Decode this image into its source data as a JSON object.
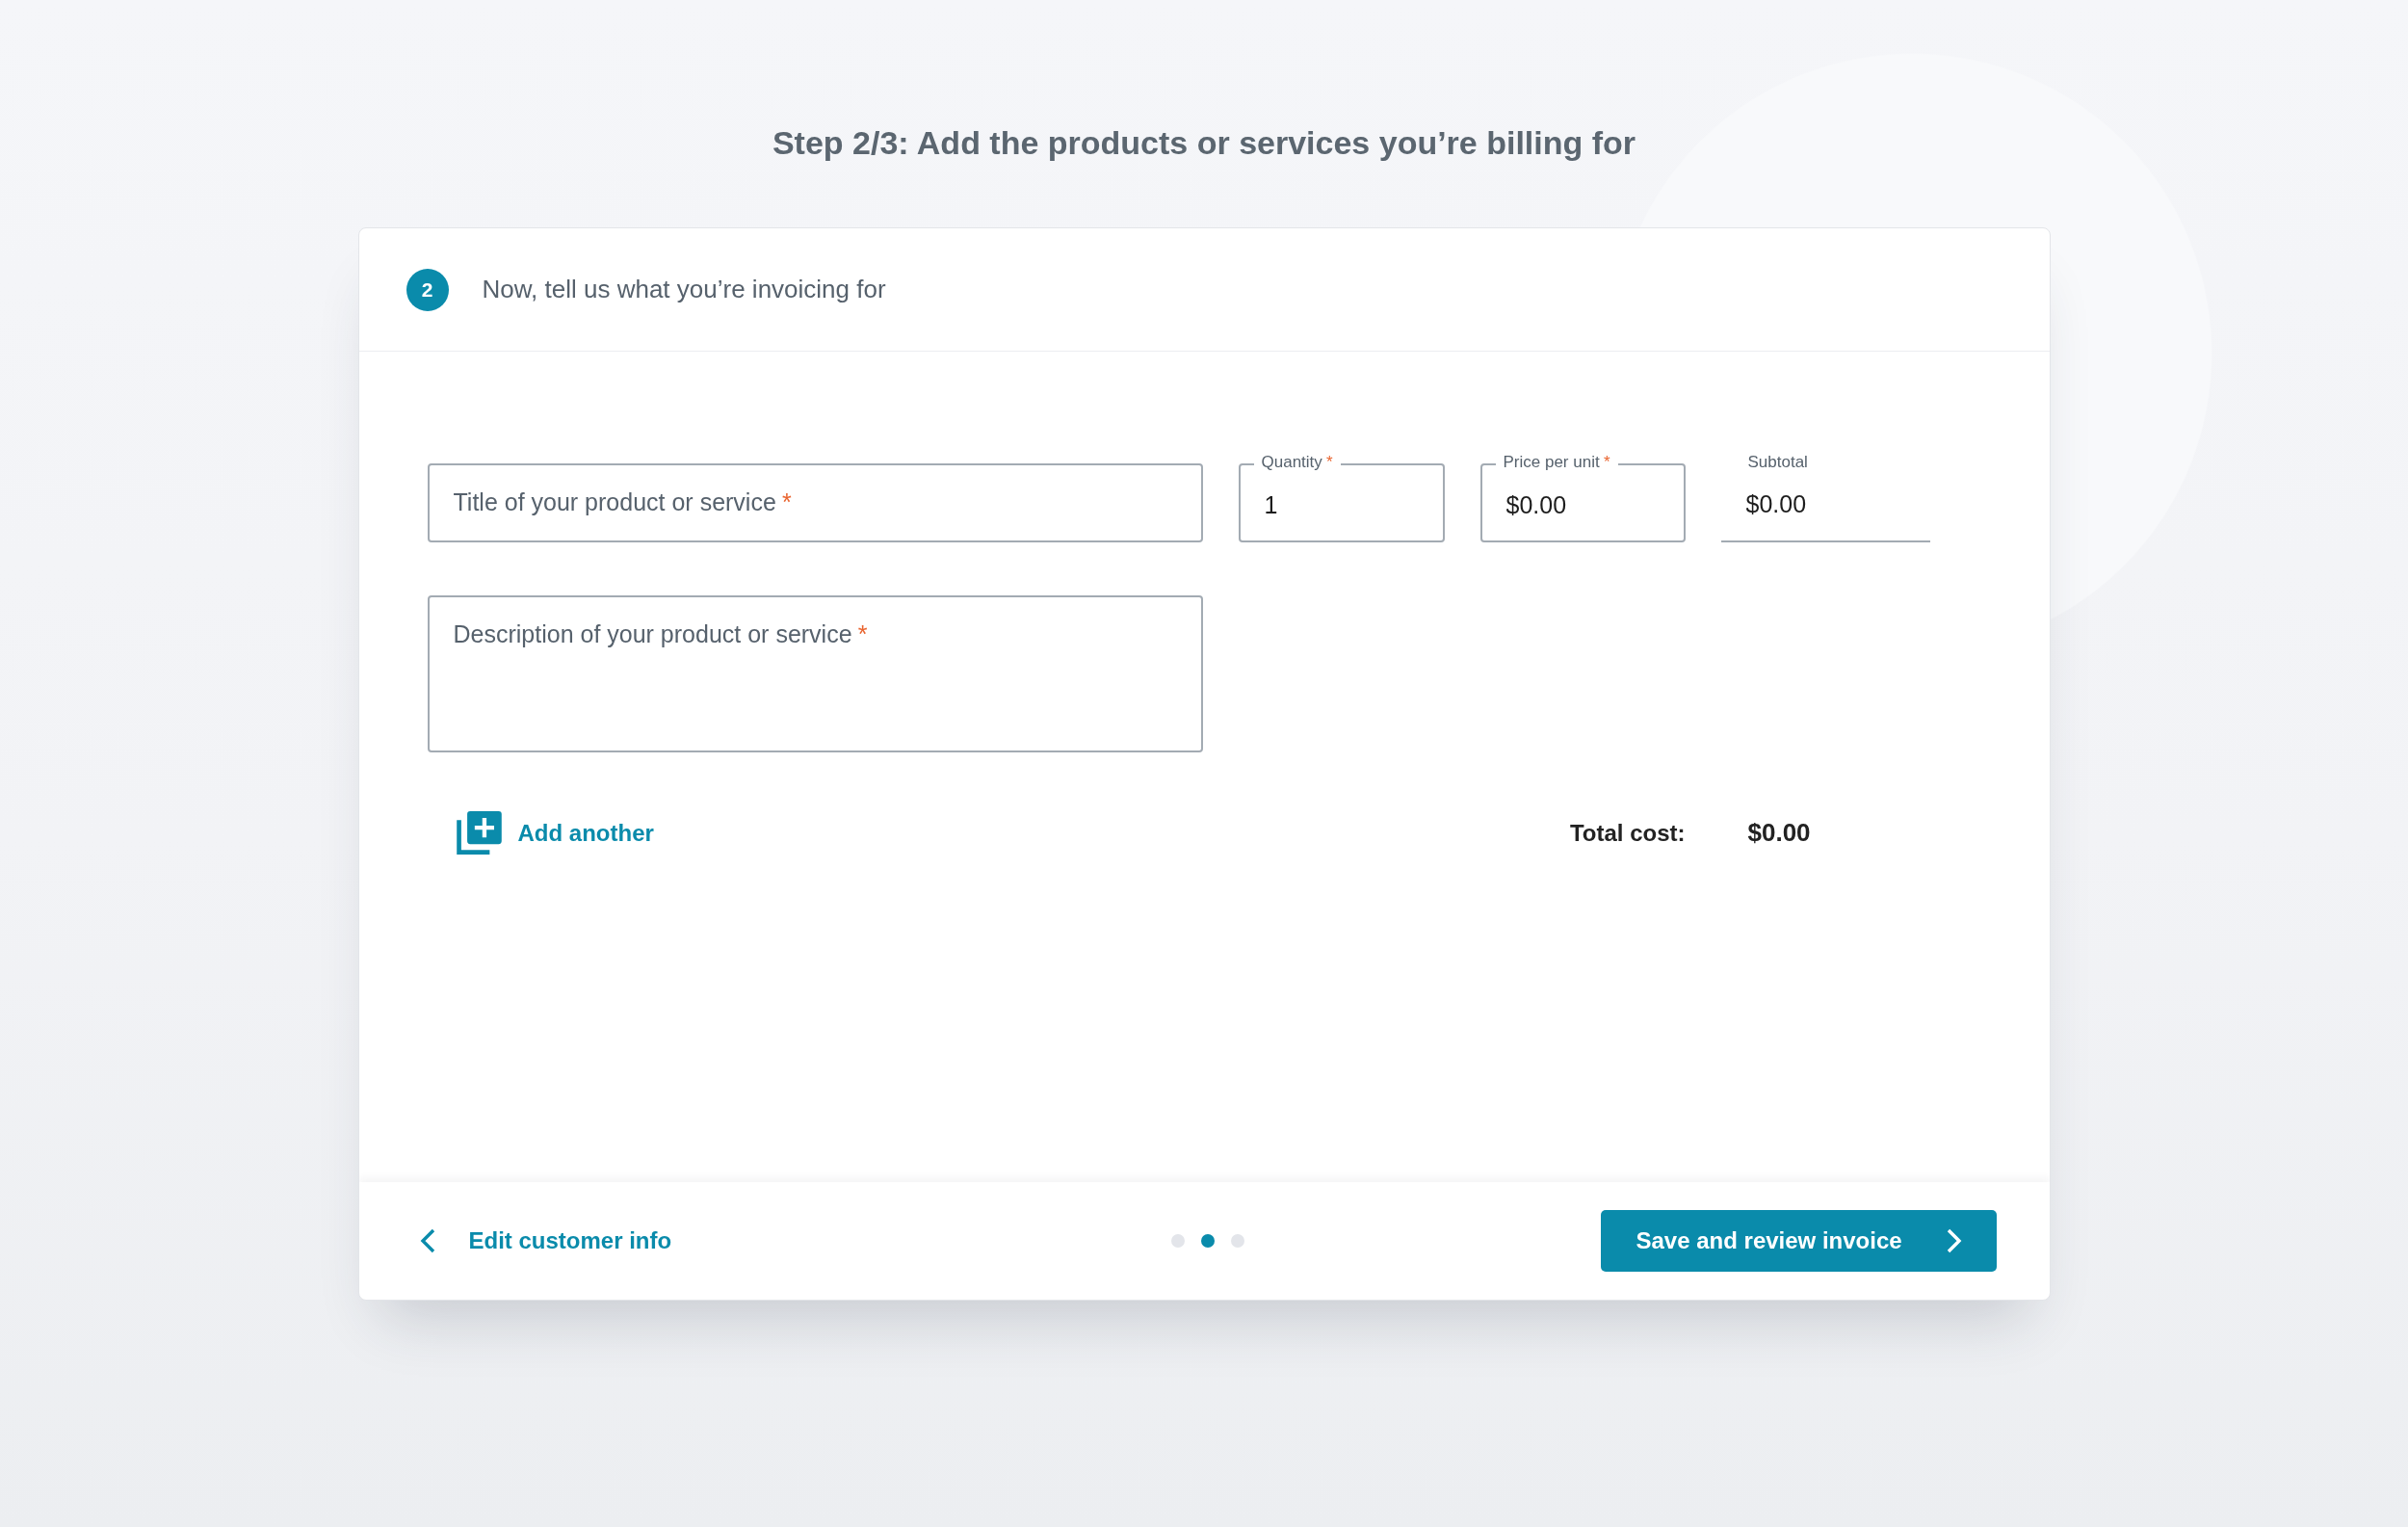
{
  "page": {
    "title": "Step 2/3: Add the products or services you’re billing for"
  },
  "card": {
    "step_number": "2",
    "heading": "Now, tell us what you’re invoicing for"
  },
  "line_item": {
    "fields": [
      {
        "kind": "outlined",
        "label": "Title of your product or service",
        "required_mark": "*"
      },
      {
        "kind": "outlined",
        "label": "Quantity",
        "required_mark": "*",
        "value": "1"
      },
      {
        "kind": "outlined",
        "label": "Price per unit",
        "required_mark": "*",
        "value": "$0.00"
      },
      {
        "kind": "underlined",
        "label": "Subtotal",
        "value": "$0.00"
      },
      {
        "kind": "multiline",
        "label": "Description of your product or service",
        "required_mark": "*"
      }
    ]
  },
  "add_another": {
    "label": "Add another"
  },
  "total": {
    "label": "Total cost:",
    "value": "$0.00"
  },
  "footer": {
    "back": {
      "label": "Edit customer info"
    },
    "steps": [
      {
        "selected": false
      },
      {
        "selected": true
      },
      {
        "selected": false
      }
    ],
    "next": {
      "label": "Save and review invoice"
    }
  }
}
